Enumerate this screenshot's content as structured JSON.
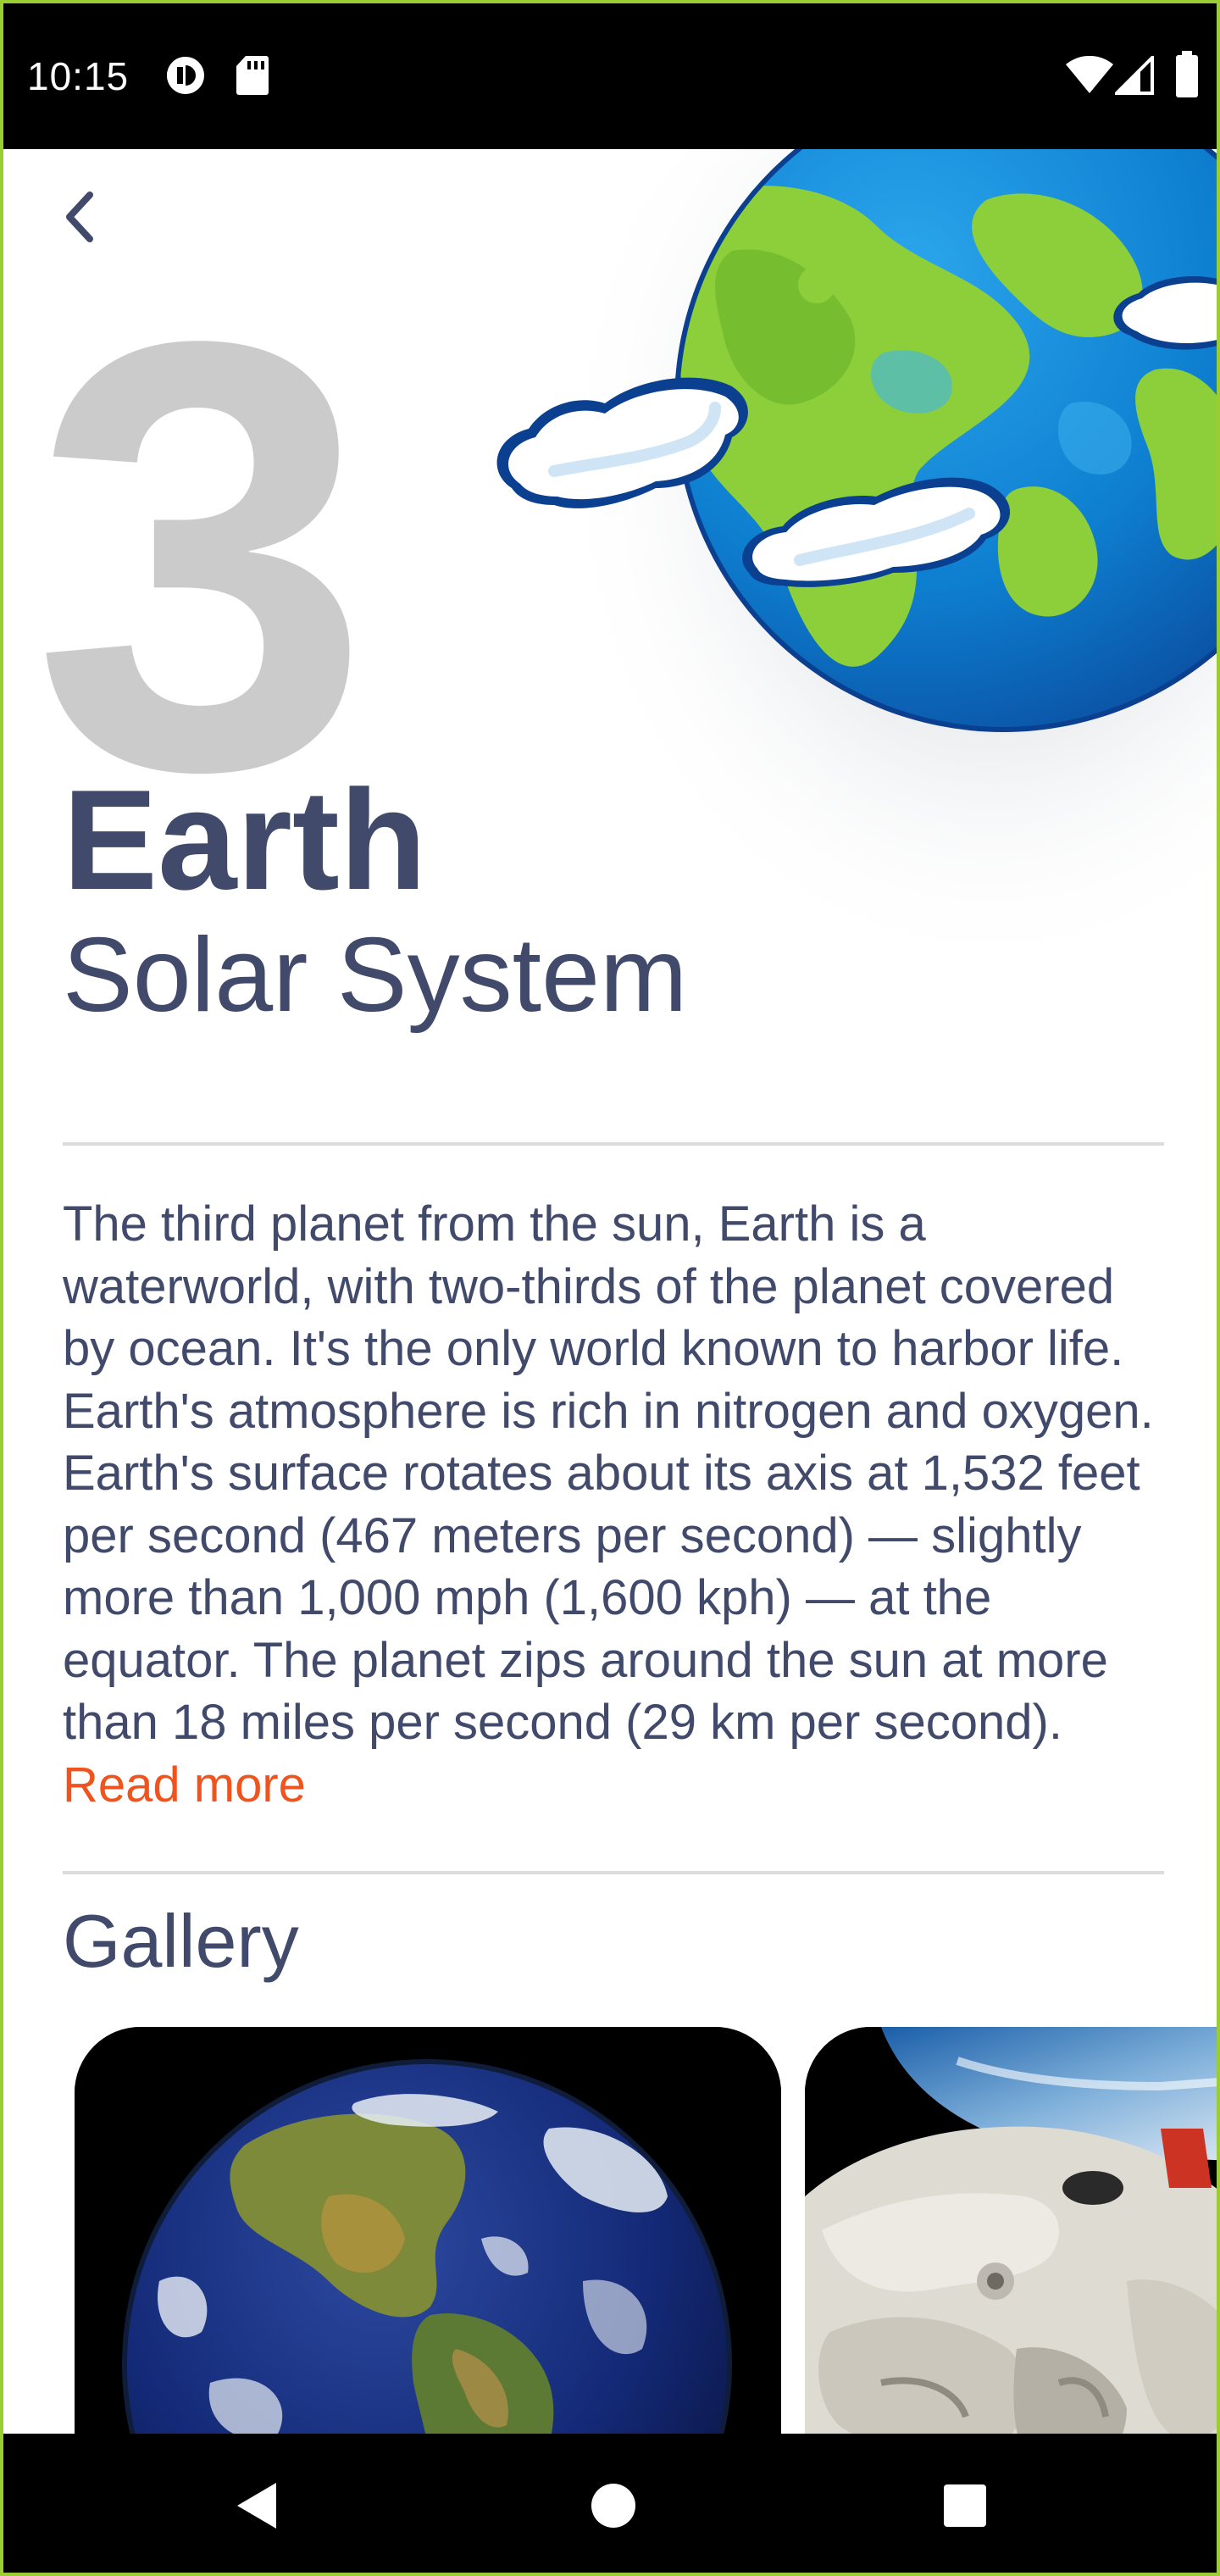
{
  "status_bar": {
    "time": "10:15",
    "icons_left": [
      "data-saver-icon",
      "sd-card-icon"
    ],
    "icons_right": [
      "wifi-icon",
      "cellular-signal-icon",
      "battery-icon"
    ]
  },
  "header": {
    "back_icon": "chevron-left-icon",
    "planet_order": "3",
    "planet_name": "Earth",
    "subtitle": "Solar System",
    "illustration": "cartoon-earth-icon"
  },
  "description": {
    "text": "The third planet from the sun, Earth is a waterworld, with two-thirds of the planet covered by ocean. It's the only world known to harbor life. Earth's atmosphere is rich in nitrogen and oxygen. Earth's surface rotates about its axis at 1,532 feet per second (467 meters per second) — slightly more than 1,000 mph (1,600 kph) — at the equator. The planet zips around the sun at more than 18 miles per second (29 km per second). ",
    "read_more": "Read more"
  },
  "gallery": {
    "title": "Gallery",
    "items": [
      {
        "name": "earth-from-space-photo"
      },
      {
        "name": "astronaut-spacewalk-photo"
      }
    ]
  },
  "nav_bar": {
    "back": "nav-back-icon",
    "home": "nav-home-icon",
    "recents": "nav-recents-icon"
  },
  "colors": {
    "title": "#414a6b",
    "number": "#cbcbcb",
    "accent": "#f0541e",
    "ocean": "#1a8fd8",
    "land": "#8ccf3a"
  }
}
